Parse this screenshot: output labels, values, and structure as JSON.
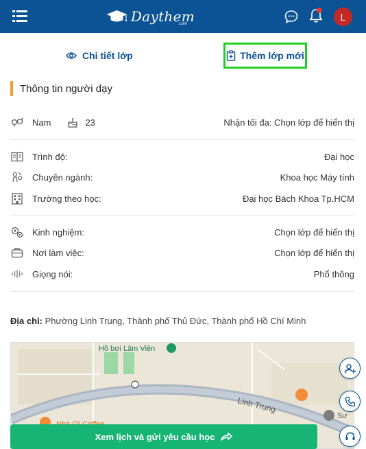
{
  "header": {
    "brand": "Daythem",
    "brand_sub": ".com",
    "avatar_letter": "L",
    "colors": {
      "bar": "#0b5394",
      "avatar": "#c62828",
      "notification_dot": "#e53935"
    }
  },
  "tabs": {
    "detail_label": "Chi tiết lớp",
    "new_label": "Thêm lớp mới"
  },
  "section": {
    "title": "Thông tin người dạy"
  },
  "profile": {
    "gender": "Nam",
    "age": "23",
    "max_receive": "Nhận tối đa: Chọn lớp để hiển thị"
  },
  "education": [
    {
      "icon": "degree-icon",
      "label": "Trình độ:",
      "value": "Đại học"
    },
    {
      "icon": "major-icon",
      "label": "Chuyên ngành:",
      "value": "Khoa học Máy tính"
    },
    {
      "icon": "school-icon",
      "label": "Trường theo học:",
      "value": "Đại học Bách Khoa Tp.HCM"
    }
  ],
  "work": [
    {
      "icon": "experience-icon",
      "label": "Kinh nghiệm:",
      "value": "Chọn lớp để hiển thị"
    },
    {
      "icon": "workplace-icon",
      "label": "Nơi làm việc:",
      "value": "Chọn lớp để hiển thị"
    },
    {
      "icon": "voice-icon",
      "label": "Giọng nói:",
      "value": "Phổ thông"
    }
  ],
  "address": {
    "label": "Địa chỉ:",
    "value": "Phường Linh Trung, Thành phố Thủ Đức, Thành phố Hồ Chí Minh"
  },
  "map": {
    "labels": {
      "pool": "Hồ bơi Lâm Viên",
      "road": "Linh Trung",
      "cafe": "Nhà Ơi Coffee",
      "su": "Sư"
    }
  },
  "cta": {
    "label": "Xem lịch và gửi yêu cầu học"
  }
}
